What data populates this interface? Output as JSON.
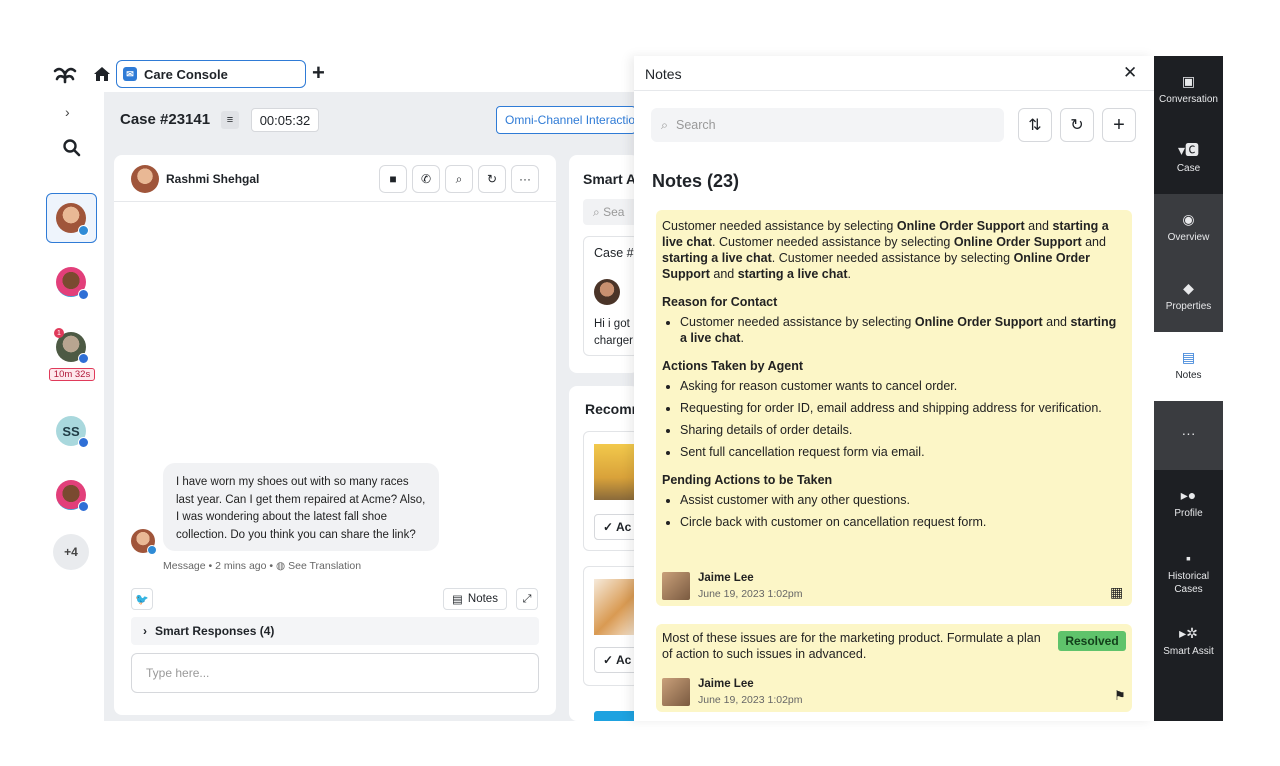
{
  "header": {
    "tab_label": "Care Console",
    "case_title": "Case #23141",
    "timer": "00:05:32",
    "omni_label": "Omni-Channel Interactions"
  },
  "left_rail": {
    "unread_count": "1",
    "wait_time": "10m 32s",
    "initials_avatar": "SS",
    "more_count": "+4"
  },
  "chat": {
    "customer_name": "Rashmi Shehgal",
    "message": "I have worn my shoes out with so many races last year. Can I get them repaired at Acme? Also, I was wondering about the latest fall shoe collection. Do you think you can share the link?",
    "meta_prefix": "Message",
    "meta_time": "2 mins ago",
    "see_translation": "See Translation",
    "notes_button": "Notes",
    "smart_responses": "Smart Responses (4)",
    "input_placeholder": "Type here..."
  },
  "smart_assist": {
    "title": "Smart A",
    "search_placeholder": "Sea",
    "case_label": "Case #",
    "snippet_line1": "Hi i got",
    "snippet_line2": "charger",
    "rec_title": "Recomm",
    "action_label": "Ac"
  },
  "notes": {
    "panel_title": "Notes",
    "search_placeholder": "Search",
    "heading": "Notes (23)",
    "note1": {
      "intro_a": "Customer needed assistance by selecting ",
      "intro_b": "Online Order Support",
      "intro_c": " and ",
      "intro_d": "starting a live chat",
      "intro_e": ". Customer needed assistance by selecting ",
      "intro_f": "Online Order Support",
      "intro_g": " and ",
      "intro_h": "starting a live chat",
      "intro_i": ". Customer needed assistance by selecting ",
      "intro_j": "Online Order Support",
      "intro_k": " and ",
      "intro_l": "starting a live chat",
      "intro_m": ".",
      "reason_heading": "Reason for Contact",
      "reason_a": "Customer needed assistance by selecting ",
      "reason_b": "Online Order Support",
      "reason_c": " and ",
      "reason_d": "starting a live chat",
      "reason_e": ".",
      "actions_heading": "Actions Taken by Agent",
      "actions": [
        "Asking for reason customer wants to cancel order.",
        "Requesting for order ID, email address and shipping address for verification.",
        "Sharing details of order details.",
        "Sent full cancellation request form via email."
      ],
      "pending_heading": "Pending Actions to be Taken",
      "pending": [
        "Assist customer with any other questions.",
        "Circle back with customer on cancellation request form."
      ],
      "author": "Jaime Lee",
      "date": "June 19, 2023 1:02pm"
    },
    "note2": {
      "text": "Most of these issues are for the marketing product. Formulate a plan of action to such issues in advanced.",
      "status": "Resolved",
      "author": "Jaime Lee",
      "date": "June 19, 2023 1:02pm"
    }
  },
  "right_rail": {
    "items": [
      "Conversation",
      "Case",
      "Overview",
      "Properties",
      "Notes",
      "Profile",
      "Historical Cases",
      "Smart Assit"
    ]
  },
  "colors": {
    "accent": "#2f7bd6",
    "note_bg": "#fcf6c7",
    "resolved": "#5fc36b",
    "rail_dark": "#1d1f23"
  }
}
